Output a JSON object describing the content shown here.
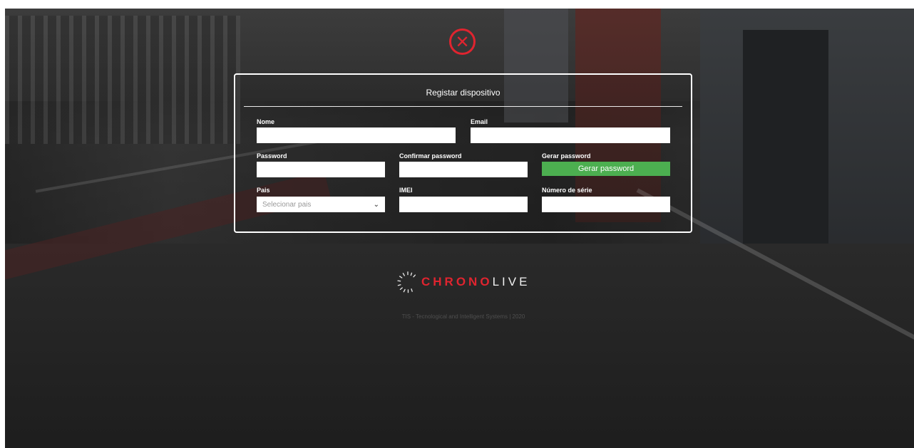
{
  "dialog": {
    "title": "Registar dispositivo",
    "close_icon": "close-circle-icon"
  },
  "form": {
    "name": {
      "label": "Nome",
      "value": ""
    },
    "email": {
      "label": "Email",
      "value": ""
    },
    "password": {
      "label": "Password",
      "value": ""
    },
    "confirm_password": {
      "label": "Confirmar password",
      "value": ""
    },
    "generate_password": {
      "label": "Gerar password",
      "button_label": "Gerar password"
    },
    "country": {
      "label": "Pais",
      "placeholder": "Selecionar pais"
    },
    "imei": {
      "label": "IMEI",
      "value": ""
    },
    "serial": {
      "label": "Número de série",
      "value": ""
    }
  },
  "brand": {
    "name_red": "CHRONO",
    "name_white": "LIVE",
    "icon": "chronolive-logo-icon"
  },
  "footer": {
    "text": "TIS - Tecnological and Intelligent Systems | 2020"
  },
  "colors": {
    "accent_red": "#e0242f",
    "button_green": "#4caf50",
    "panel_border": "#ffffff"
  }
}
